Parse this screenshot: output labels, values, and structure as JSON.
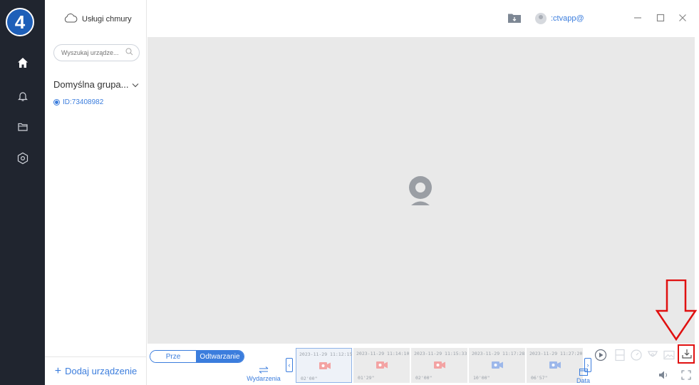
{
  "step_badge": "4",
  "sidebar": {
    "cloud_label": "Usługi chmury",
    "search_placeholder": "Wyszukaj urządze...",
    "group_label": "Domyślna grupa...",
    "device_label": "ID:73408982",
    "add_device_label": "Dodaj urządzenie"
  },
  "rail": {
    "items": [
      "home-icon",
      "bell-icon",
      "folder-icon",
      "settings-icon"
    ]
  },
  "topbar": {
    "user_label": ":ctvapp@"
  },
  "bottombar": {
    "mode_live": "Prze",
    "mode_playback": "Odtwarzanie",
    "events_label": "Wydarzenia",
    "date_label": "Data",
    "clips": [
      {
        "timestamp": "2023-11-29 11:12:15",
        "duration": "02'00\"",
        "type": "alarm"
      },
      {
        "timestamp": "2023-11-29 11:14:10",
        "duration": "01'29\"",
        "type": "alarm"
      },
      {
        "timestamp": "2023-11-29 11:15:33",
        "duration": "02'00\"",
        "type": "alarm"
      },
      {
        "timestamp": "2023-11-29 11:17:28",
        "duration": "10'00\"",
        "type": "normal"
      },
      {
        "timestamp": "2023-11-29 11:27:20",
        "duration": "06'57\"",
        "type": "normal"
      }
    ]
  },
  "colors": {
    "accent": "#3b7ddd",
    "rail": "#20252f",
    "alarm": "#f3a3a3",
    "normal": "#9db8ea",
    "annotation": "#e01010"
  }
}
